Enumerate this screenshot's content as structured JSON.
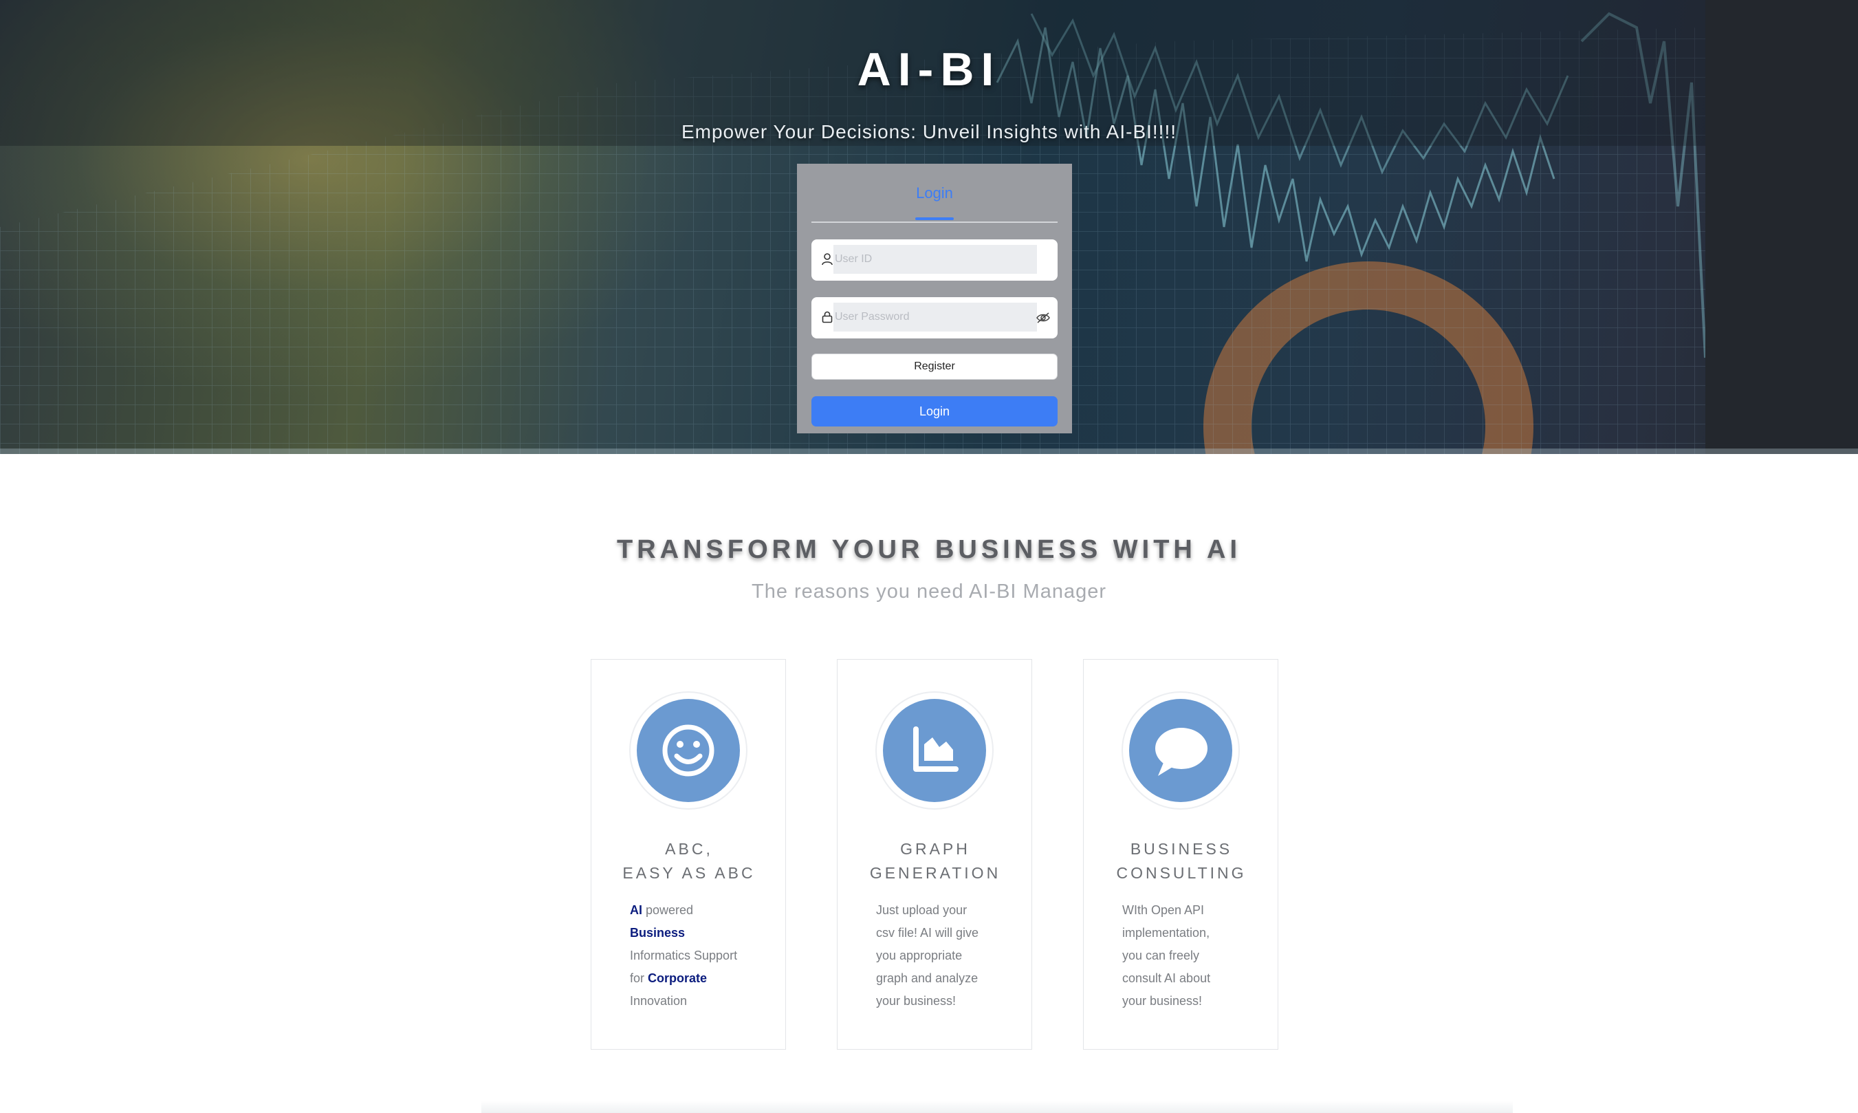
{
  "hero": {
    "title": "AI-BI",
    "subtitle": "Empower Your Decisions: Unveil Insights with AI-BI!!!!"
  },
  "login": {
    "tab_label": "Login",
    "user_id_placeholder": "User ID",
    "password_placeholder": "User Password",
    "register_label": "Register",
    "login_label": "Login",
    "accent_color": "#3d7df5"
  },
  "features": {
    "title": "TRANSFORM YOUR BUSINESS WITH AI",
    "subtitle": "The reasons you need AI-BI Manager",
    "cards": [
      {
        "icon": "smile-icon",
        "title_line1": "ABC,",
        "title_line2": "EASY AS ABC",
        "text": [
          {
            "bold": "AI",
            "rest": " powered"
          },
          {
            "bold": "Business",
            "rest": ""
          },
          {
            "bold": "",
            "rest": "Informatics Support"
          },
          {
            "bold": "Corporate",
            "pre": "for ",
            "rest": ""
          },
          {
            "bold": "",
            "rest": "Innovation"
          }
        ]
      },
      {
        "icon": "area-chart-icon",
        "title_line1": "GRAPH",
        "title_line2": "GENERATION",
        "lines": [
          "Just upload your",
          "csv file! AI will give",
          "you appropriate",
          "graph and analyze",
          "your business!"
        ]
      },
      {
        "icon": "chat-bubble-icon",
        "title_line1": "BUSINESS",
        "title_line2": "CONSULTING",
        "lines": [
          "WIth Open API",
          "implementation,",
          "you can freely",
          "consult AI about",
          "your business!"
        ]
      }
    ],
    "icon_color": "#6b9ad1"
  }
}
